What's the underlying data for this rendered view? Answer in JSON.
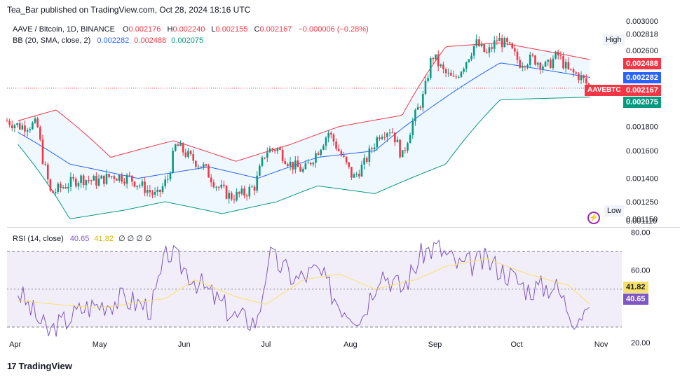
{
  "header": {
    "published": "Tea_Bar published on TradingView.com, Oct 28, 2024 18:16 UTC"
  },
  "legend": {
    "symbol": "AAVE / Bitcoin, 1D, BINANCE",
    "o_label": "O",
    "o": "0.002176",
    "h_label": "H",
    "h": "0.002240",
    "l_label": "L",
    "l": "0.002155",
    "c_label": "C",
    "c": "0.002167",
    "change": "−0.000006 (−0.28%)",
    "bb_label": "BB (20, SMA, close, 2)",
    "bb_basis": "0.002282",
    "bb_upper": "0.002488",
    "bb_lower": "0.002075",
    "rsi_label": "RSI (14, close)",
    "rsi": "40.65",
    "rsi_ma": "41.82",
    "rsi_extra": "∅ ∅ ∅ ∅"
  },
  "price_axis": {
    "ticks": [
      "0.003000",
      "0.002818",
      "0.002600",
      "0.002488",
      "0.002282",
      "0.002167",
      "0.002075",
      "0.001800",
      "0.001600",
      "0.001400",
      "0.001250",
      "0.001150",
      "0.001110"
    ]
  },
  "tags": {
    "high_label": "High",
    "high_value": "0.002818",
    "low_label": "Low",
    "low_value": "0.001150",
    "symbol_tag": "AAVEBTC",
    "upper_value": "0.002488",
    "basis_value": "0.002282",
    "close_value": "0.002167",
    "lower_value": "0.002075"
  },
  "rsi_axis": {
    "ticks": [
      "80.00",
      "60.00",
      "41.82",
      "40.65",
      "20.00"
    ]
  },
  "time_axis": {
    "labels": [
      "Apr",
      "May",
      "Jun",
      "Jul",
      "Aug",
      "Sep",
      "Oct",
      "Nov"
    ]
  },
  "footer": {
    "brand": "TradingView",
    "logo": "17"
  },
  "colors": {
    "up": "#089981",
    "down": "#f23645",
    "upper": "#f23645",
    "basis": "#2962ff",
    "lower": "#089981",
    "rsi": "#7e57c2",
    "rsi_ma": "#f7e16b",
    "fill": "#2196f3"
  },
  "chart_data": {
    "type": "candlestick",
    "title": "AAVE / Bitcoin, 1D, BINANCE",
    "ylim": [
      0.00111,
      0.003
    ],
    "yscale": "log",
    "x_range": [
      "2024-03-28",
      "2024-11-06"
    ],
    "last_close": 0.002167,
    "indicators": {
      "bollinger": {
        "upper": 0.002488,
        "basis": 0.002282,
        "lower": 0.002075
      },
      "rsi": {
        "value": 40.65,
        "ma": 41.82,
        "levels": [
          70,
          50,
          30
        ]
      }
    },
    "series": [
      {
        "name": "close",
        "points": [
          [
            "03-28",
            0.00185
          ],
          [
            "04-02",
            0.0018
          ],
          [
            "04-08",
            0.00182
          ],
          [
            "04-10",
            0.00155
          ],
          [
            "04-13",
            0.0013
          ],
          [
            "04-18",
            0.00135
          ],
          [
            "04-24",
            0.0014
          ],
          [
            "04-30",
            0.00138
          ],
          [
            "05-06",
            0.00142
          ],
          [
            "05-12",
            0.0014
          ],
          [
            "05-18",
            0.00133
          ],
          [
            "05-22",
            0.00128
          ],
          [
            "05-26",
            0.0014
          ],
          [
            "05-29",
            0.00165
          ],
          [
            "06-03",
            0.00155
          ],
          [
            "06-08",
            0.00148
          ],
          [
            "06-13",
            0.00135
          ],
          [
            "06-18",
            0.00128
          ],
          [
            "06-23",
            0.0013
          ],
          [
            "06-27",
            0.00135
          ],
          [
            "07-01",
            0.0016
          ],
          [
            "07-05",
            0.00162
          ],
          [
            "07-10",
            0.0015
          ],
          [
            "07-15",
            0.00145
          ],
          [
            "07-20",
            0.0016
          ],
          [
            "07-24",
            0.00175
          ],
          [
            "07-29",
            0.00155
          ],
          [
            "08-02",
            0.0014
          ],
          [
            "08-06",
            0.0015
          ],
          [
            "08-12",
            0.00175
          ],
          [
            "08-16",
            0.00178
          ],
          [
            "08-20",
            0.00155
          ],
          [
            "08-24",
            0.00185
          ],
          [
            "08-28",
            0.0021
          ],
          [
            "08-31",
            0.00255
          ],
          [
            "09-04",
            0.00235
          ],
          [
            "09-08",
            0.00225
          ],
          [
            "09-12",
            0.00245
          ],
          [
            "09-16",
            0.0027
          ],
          [
            "09-20",
            0.00255
          ],
          [
            "09-24",
            0.00275
          ],
          [
            "09-28",
            0.00265
          ],
          [
            "10-02",
            0.00245
          ],
          [
            "10-07",
            0.0025
          ],
          [
            "10-12",
            0.0024
          ],
          [
            "10-16",
            0.00255
          ],
          [
            "10-20",
            0.00235
          ],
          [
            "10-24",
            0.0023
          ],
          [
            "10-28",
            0.002167
          ]
        ]
      },
      {
        "name": "BB upper",
        "points": [
          [
            "04-01",
            0.00185
          ],
          [
            "04-15",
            0.00195
          ],
          [
            "05-05",
            0.00155
          ],
          [
            "05-28",
            0.00168
          ],
          [
            "06-20",
            0.00152
          ],
          [
            "07-10",
            0.00165
          ],
          [
            "07-28",
            0.0018
          ],
          [
            "08-20",
            0.0019
          ],
          [
            "09-05",
            0.00265
          ],
          [
            "09-25",
            0.0027
          ],
          [
            "10-28",
            0.002488
          ]
        ]
      },
      {
        "name": "BB basis",
        "points": [
          [
            "04-01",
            0.00175
          ],
          [
            "04-20",
            0.0015
          ],
          [
            "05-15",
            0.0014
          ],
          [
            "06-10",
            0.00148
          ],
          [
            "06-28",
            0.0014
          ],
          [
            "07-20",
            0.00155
          ],
          [
            "08-10",
            0.0016
          ],
          [
            "09-01",
            0.002
          ],
          [
            "09-25",
            0.00245
          ],
          [
            "10-28",
            0.002282
          ]
        ]
      },
      {
        "name": "BB lower",
        "points": [
          [
            "04-01",
            0.00165
          ],
          [
            "04-20",
            0.00115
          ],
          [
            "05-10",
            0.0012
          ],
          [
            "05-25",
            0.00125
          ],
          [
            "06-15",
            0.00118
          ],
          [
            "07-05",
            0.00125
          ],
          [
            "07-20",
            0.00135
          ],
          [
            "08-10",
            0.0013
          ],
          [
            "09-05",
            0.0015
          ],
          [
            "09-25",
            0.00205
          ],
          [
            "10-28",
            0.002075
          ]
        ]
      },
      {
        "name": "RSI",
        "points": [
          [
            "04-01",
            49
          ],
          [
            "04-12",
            27
          ],
          [
            "04-25",
            40
          ],
          [
            "05-10",
            45
          ],
          [
            "05-20",
            40
          ],
          [
            "05-26",
            70
          ],
          [
            "06-05",
            55
          ],
          [
            "06-20",
            35
          ],
          [
            "06-28",
            33
          ],
          [
            "07-02",
            68
          ],
          [
            "07-12",
            55
          ],
          [
            "07-20",
            60
          ],
          [
            "07-28",
            42
          ],
          [
            "08-05",
            35
          ],
          [
            "08-12",
            60
          ],
          [
            "08-20",
            50
          ],
          [
            "08-28",
            70
          ],
          [
            "09-02",
            72
          ],
          [
            "09-10",
            62
          ],
          [
            "09-20",
            65
          ],
          [
            "09-28",
            58
          ],
          [
            "10-05",
            50
          ],
          [
            "10-15",
            52
          ],
          [
            "10-22",
            35
          ],
          [
            "10-28",
            40.65
          ]
        ]
      },
      {
        "name": "RSI MA",
        "points": [
          [
            "04-01",
            44
          ],
          [
            "04-15",
            42
          ],
          [
            "05-01",
            40
          ],
          [
            "05-15",
            43
          ],
          [
            "05-25",
            45
          ],
          [
            "06-05",
            55
          ],
          [
            "06-20",
            46
          ],
          [
            "07-01",
            42
          ],
          [
            "07-15",
            55
          ],
          [
            "07-28",
            58
          ],
          [
            "08-10",
            50
          ],
          [
            "08-25",
            55
          ],
          [
            "09-05",
            62
          ],
          [
            "09-20",
            66
          ],
          [
            "10-05",
            58
          ],
          [
            "10-20",
            52
          ],
          [
            "10-28",
            41.82
          ]
        ]
      }
    ]
  }
}
